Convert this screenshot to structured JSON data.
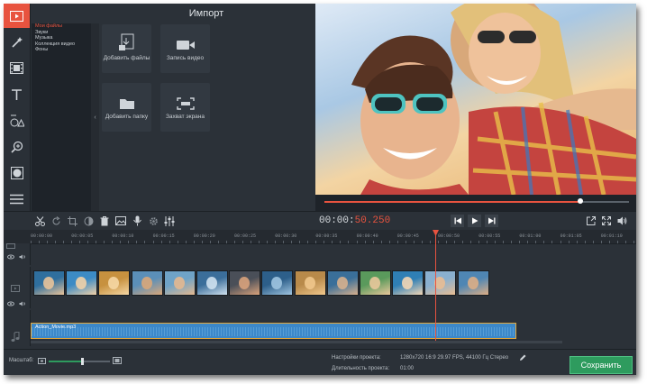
{
  "import_panel": {
    "title": "Импорт",
    "categories": [
      "Мои файлы",
      "Звуки",
      "Музыка",
      "Коллекция видео",
      "Фоны"
    ],
    "selected_category": "Мои файлы",
    "collapse_glyph": "‹",
    "tiles": [
      {
        "label": "Добавить файлы",
        "icon": "add-files-icon"
      },
      {
        "label": "Запись видео",
        "icon": "camera-icon"
      },
      {
        "label": "Добавить папку",
        "icon": "folder-icon"
      },
      {
        "label": "Захват экрана",
        "icon": "screen-capture-icon"
      }
    ]
  },
  "preview": {
    "progress": 0.84
  },
  "player": {
    "time_main": "00:00:",
    "time_fraction": "50.250"
  },
  "timeline": {
    "ruler": [
      "00:00:00",
      "00:00:05",
      "00:00:10",
      "00:00:15",
      "00:00:20",
      "00:00:25",
      "00:00:30",
      "00:00:35",
      "00:00:40",
      "00:00:45",
      "00:00:50",
      "00:00:55",
      "00:01:00",
      "00:01:05",
      "00:01:10"
    ],
    "audio_clip_name": "Action_Movie.mp3",
    "playhead_time": "00:00:50.250"
  },
  "statusbar": {
    "zoom_label": "Масштаб:",
    "project_settings_label": "Настройки проекта:",
    "project_settings_value": "1280x720 16:9 29.97 FPS, 44100 Гц Стерео",
    "duration_label": "Длительность проекта:",
    "duration_value": "01:00",
    "zoom_level": 0.55
  },
  "save_button": {
    "label": "Сохранить"
  },
  "colors": {
    "accent": "#e8533f",
    "save": "#2e9b5e",
    "audio_clip": "#3c88c9",
    "panel_bg": "#2b3138"
  }
}
